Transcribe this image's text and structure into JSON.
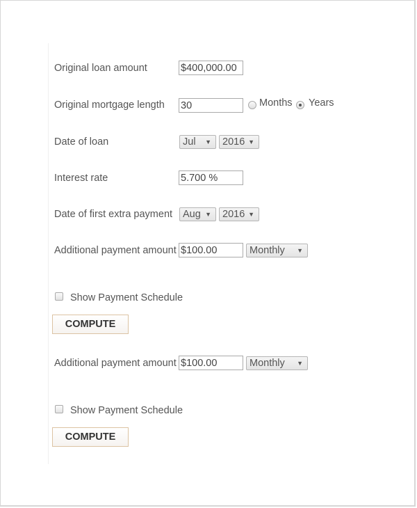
{
  "form": {
    "loan_amount": {
      "label": "Original loan amount",
      "value": "$400,000.00"
    },
    "mortgage_length": {
      "label": "Original mortgage length",
      "value": "30",
      "unit_options": [
        {
          "label": "Months",
          "selected": false
        },
        {
          "label": "Years",
          "selected": true
        }
      ]
    },
    "loan_date": {
      "label": "Date of loan",
      "month": "Jul",
      "year": "2016"
    },
    "interest_rate": {
      "label": "Interest rate",
      "value": "5.700 %"
    },
    "first_extra_payment_date": {
      "label": "Date of first extra payment",
      "month": "Aug",
      "year": "2016"
    },
    "sections": [
      {
        "additional_payment_label": "Additional payment amount",
        "additional_payment_value": "$100.00",
        "frequency": "Monthly",
        "show_schedule_label": "Show Payment Schedule",
        "show_schedule_checked": false,
        "compute_label": "COMPUTE"
      },
      {
        "additional_payment_label": "Additional payment amount",
        "additional_payment_value": "$100.00",
        "frequency": "Monthly",
        "show_schedule_label": "Show Payment Schedule",
        "show_schedule_checked": false,
        "compute_label": "COMPUTE"
      }
    ],
    "dropdown_arrow": "▼"
  }
}
